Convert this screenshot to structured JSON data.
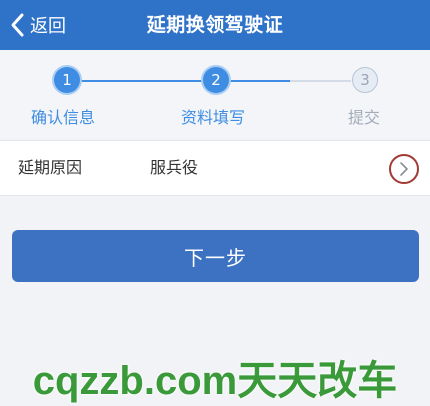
{
  "header": {
    "back_label": "返回",
    "title": "延期换领驾驶证",
    "back_icon": "chevron-left-icon"
  },
  "steps": [
    {
      "number": "1",
      "label": "确认信息",
      "state": "done"
    },
    {
      "number": "2",
      "label": "资料填写",
      "state": "current"
    },
    {
      "number": "3",
      "label": "提交",
      "state": "pending"
    }
  ],
  "form": {
    "reason_label": "延期原因",
    "reason_value": "服兵役",
    "reason_icon": "chevron-right-icon"
  },
  "actions": {
    "next_label": "下一步"
  },
  "watermark": {
    "text": "cqzzb.com天天改车"
  },
  "colors": {
    "header_bg": "#2f73c9",
    "accent": "#3f8de2",
    "button_bg": "#3c72c1",
    "watermark": "#3a9a3a"
  }
}
